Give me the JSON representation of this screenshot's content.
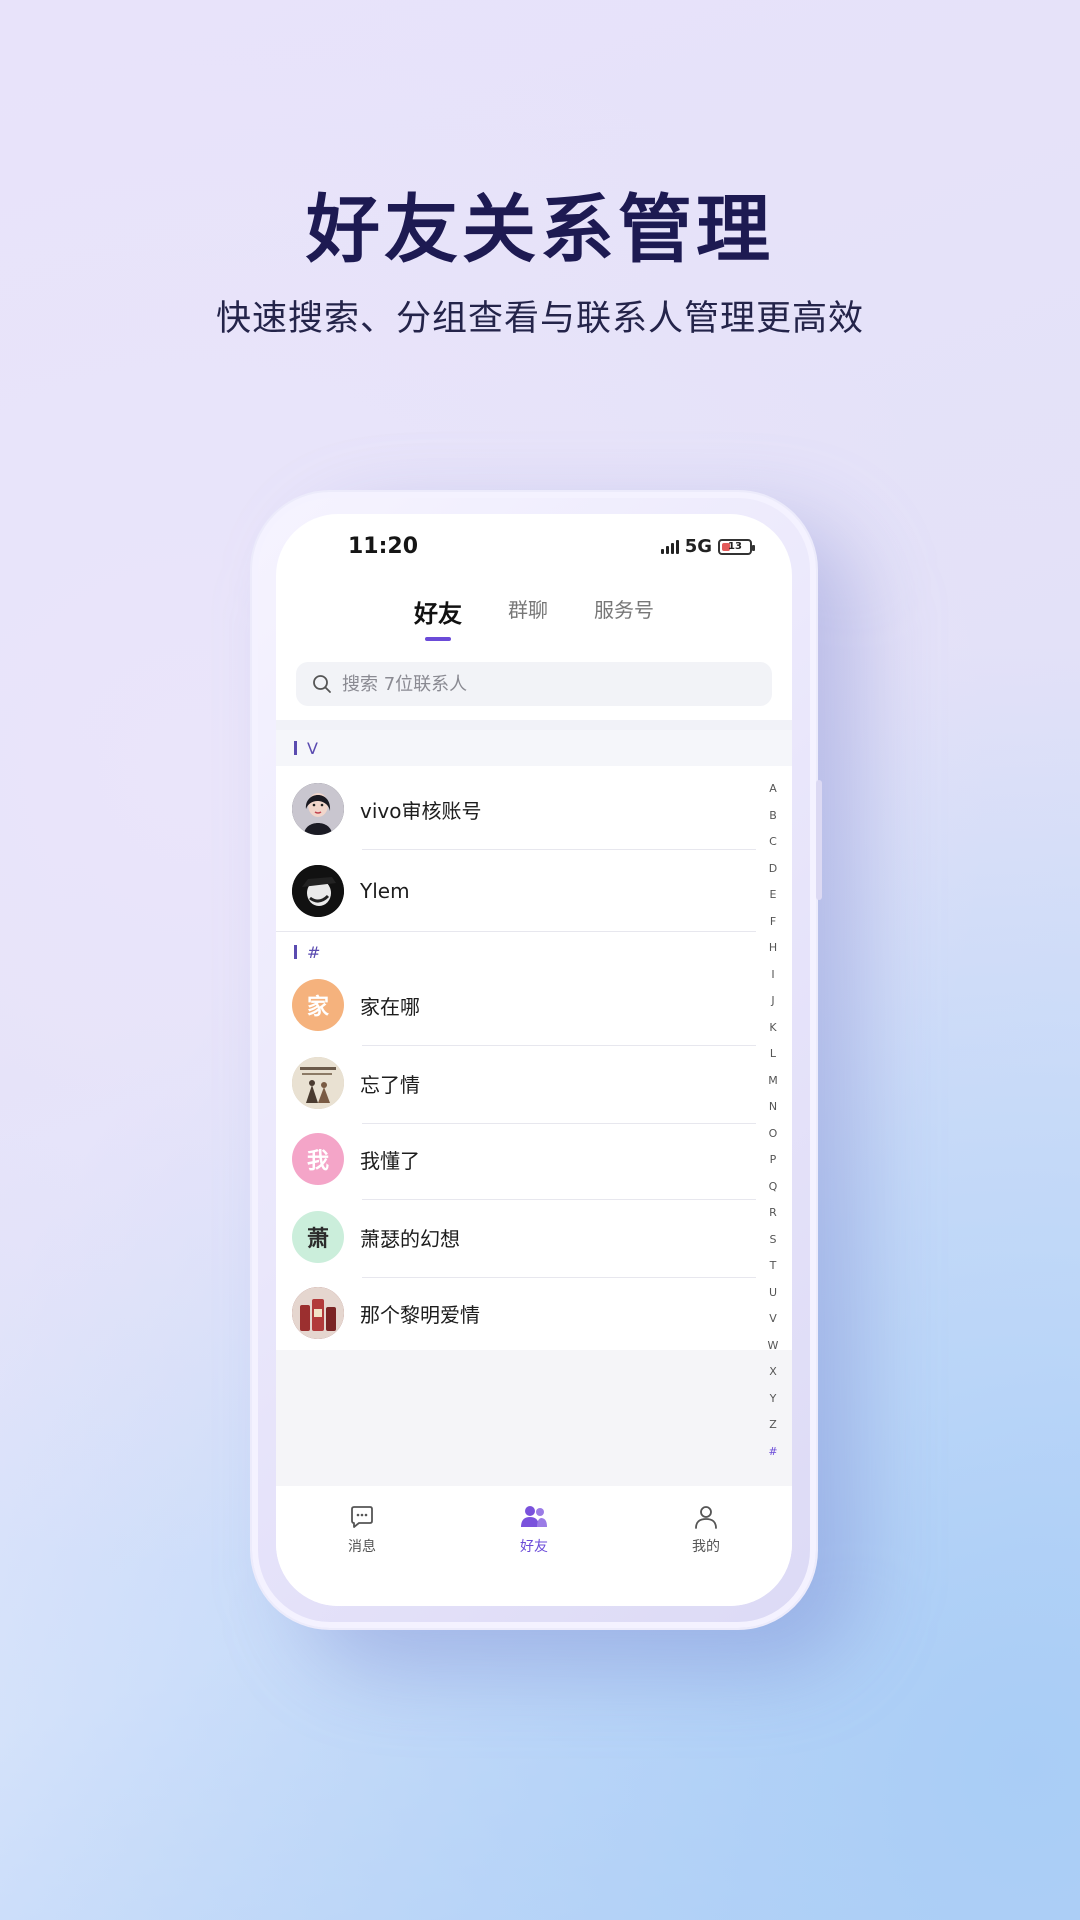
{
  "promo": {
    "headline": "好友关系管理",
    "subline": "快速搜索、分组查看与联系人管理更高效"
  },
  "status_bar": {
    "time": "11:20",
    "network": "5G",
    "battery": "13"
  },
  "tabs": [
    {
      "label": "好友",
      "active": true
    },
    {
      "label": "群聊",
      "active": false
    },
    {
      "label": "服务号",
      "active": false
    }
  ],
  "search": {
    "placeholder": "搜索 7位联系人",
    "icon": "search-icon"
  },
  "sections": [
    {
      "letter": "V",
      "contacts": [
        {
          "name": "vivo审核账号",
          "avatar": "photo",
          "avatar_color": "#3b3b46"
        },
        {
          "name": "Ylem",
          "avatar": "photo",
          "avatar_color": "#111111"
        }
      ]
    },
    {
      "letter": "#",
      "contacts": [
        {
          "name": "家在哪",
          "avatar": "text",
          "avatar_text": "家",
          "avatar_color": "#f5b27d"
        },
        {
          "name": "忘了情",
          "avatar": "photo",
          "avatar_color": "#cdbfa8"
        },
        {
          "name": "我懂了",
          "avatar": "text",
          "avatar_text": "我",
          "avatar_color": "#f4a5c8"
        },
        {
          "name": "萧瑟的幻想",
          "avatar": "text",
          "avatar_text": "萧",
          "avatar_color": "#cbeedb"
        },
        {
          "name": "那个黎明爱情",
          "avatar": "photo",
          "avatar_color": "#8a3a3a"
        }
      ]
    }
  ],
  "index_letters": [
    "A",
    "B",
    "C",
    "D",
    "E",
    "F",
    "H",
    "I",
    "J",
    "K",
    "L",
    "M",
    "N",
    "O",
    "P",
    "Q",
    "R",
    "S",
    "T",
    "U",
    "V",
    "W",
    "X",
    "Y",
    "Z",
    "#"
  ],
  "bottom_nav": [
    {
      "label": "消息",
      "icon": "chat-bubble-icon",
      "active": false
    },
    {
      "label": "好友",
      "icon": "friends-icon",
      "active": true
    },
    {
      "label": "我的",
      "icon": "person-icon",
      "active": false
    }
  ],
  "colors": {
    "accent": "#6b4bd8",
    "headline": "#1d1a52"
  }
}
